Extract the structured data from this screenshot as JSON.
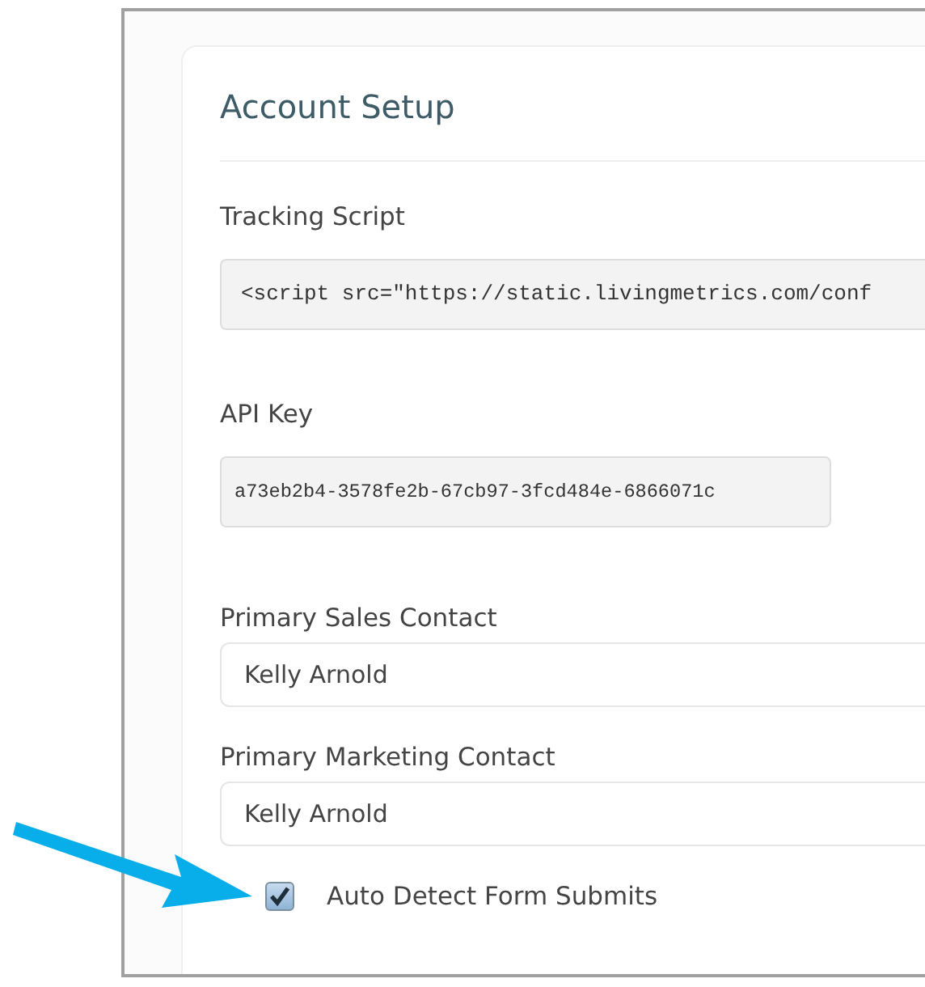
{
  "card": {
    "title": "Account Setup"
  },
  "fields": [
    {
      "kind": "code",
      "label": "Tracking Script",
      "value": "<script src=\"https://static.livingmetrics.com/conf"
    },
    {
      "kind": "code-short",
      "label": "API Key",
      "value": "a73eb2b4-3578fe2b-67cb97-3fcd484e-6866071c"
    },
    {
      "kind": "select",
      "label": "Primary Sales Contact",
      "value": "Kelly Arnold"
    },
    {
      "kind": "select",
      "label": "Primary Marketing Contact",
      "value": "Kelly Arnold"
    }
  ],
  "checkboxes": [
    {
      "label": "Auto Detect Form Submits",
      "checked": true
    }
  ]
}
